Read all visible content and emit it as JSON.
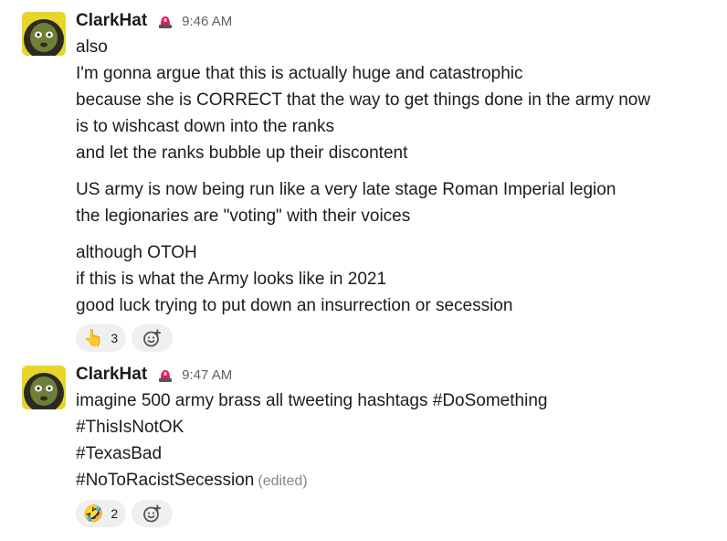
{
  "messages": [
    {
      "author": "ClarkHat",
      "status_icon": "rotating-light-icon",
      "time": "9:46 AM",
      "blocks": [
        [
          "also",
          "I'm gonna argue that this is actually huge and catastrophic",
          "because she is CORRECT that the way to get things done in the army now",
          "is to wishcast down into the ranks",
          "and let the ranks bubble up their discontent"
        ],
        [
          "US army is now being run like a very late stage Roman Imperial legion",
          "the legionaries are \"voting\" with their voices"
        ],
        [
          "although OTOH",
          "if this is what the Army looks like in 2021",
          "good luck trying to put down an insurrection or secession"
        ]
      ],
      "reactions": [
        {
          "emoji": "👆",
          "icon": "point-up-icon",
          "count": "3"
        }
      ],
      "add_reaction_icon": "add-reaction-icon"
    },
    {
      "author": "ClarkHat",
      "status_icon": "rotating-light-icon",
      "time": "9:47 AM",
      "blocks": [
        [
          "imagine 500 army brass all tweeting hashtags #DoSomething",
          "#ThisIsNotOK",
          "#TexasBad",
          "#NoToRacistSecession"
        ]
      ],
      "edited": "(edited)",
      "reactions": [
        {
          "emoji": "🤣",
          "icon": "rolling-laughing-icon",
          "count": "2"
        }
      ],
      "add_reaction_icon": "add-reaction-icon"
    }
  ],
  "colors": {
    "text": "#1d1c1d",
    "timestamp": "#616061",
    "edited": "#868686",
    "pill_bg": "#efefef",
    "avatar_bg": "#e8d52a",
    "status_red": "#e01e5a"
  }
}
